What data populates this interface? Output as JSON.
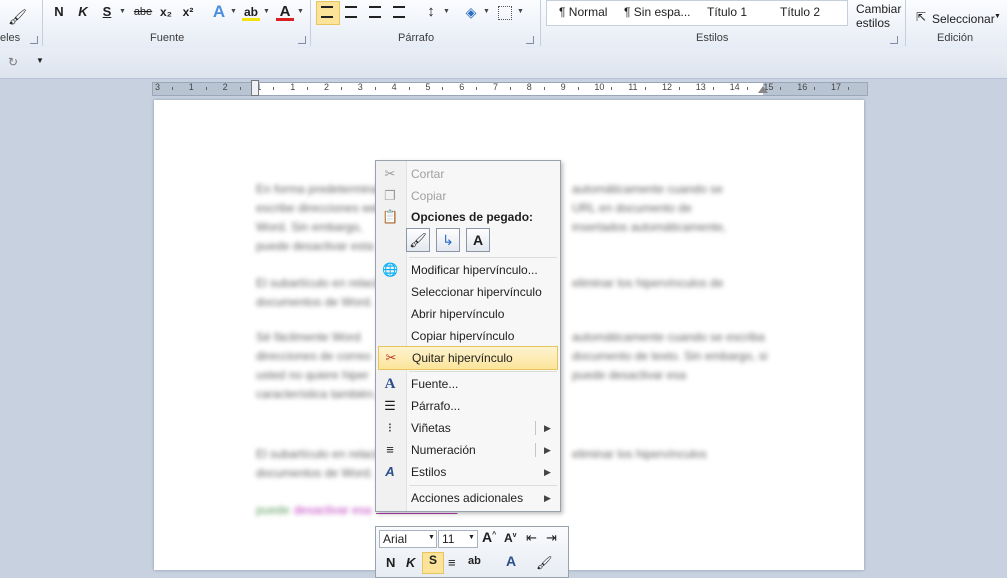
{
  "ribbon": {
    "clipboard_label": "eles",
    "font_group_label": "Fuente",
    "paragraph_group_label": "Párrafo",
    "styles_group_label": "Estilos",
    "edit_group_label": "Edición",
    "bold": "N",
    "italic": "K",
    "underline": "S",
    "strike": "abe",
    "subscript": "x₂",
    "superscript": "x²",
    "styles": [
      "¶ Normal",
      "¶ Sin espa...",
      "Título 1",
      "Título 2"
    ],
    "change_styles": "Cambiar\nestilos",
    "change_styles_l1": "Cambiar",
    "change_styles_l2": "estilos",
    "select": "Seleccionar",
    "accent_color": "#f6d56c"
  },
  "ruler": {
    "numbers": [
      "3",
      "1",
      "2",
      "1",
      "1",
      "2",
      "3",
      "4",
      "5",
      "6",
      "7",
      "8",
      "9",
      "10",
      "11",
      "12",
      "13",
      "14",
      "15",
      "16",
      "17"
    ]
  },
  "context_menu": {
    "cut": "Cortar",
    "copy": "Copiar",
    "paste_options": "Opciones de pegado:",
    "modify_link": "Modificar hipervínculo...",
    "select_link": "Seleccionar hipervínculo",
    "open_link": "Abrir hipervínculo",
    "copy_link": "Copiar hipervínculo",
    "remove_link": "Quitar hipervínculo",
    "font": "Fuente...",
    "paragraph": "Párrafo...",
    "bullets": "Viñetas",
    "numbering": "Numeración",
    "styles": "Estilos",
    "more_actions": "Acciones adicionales"
  },
  "mini_toolbar": {
    "font_name": "Arial",
    "font_size": "11"
  },
  "document": {
    "visible_text": "también."
  },
  "colors": {
    "highlight_item": "#fbe49a",
    "page": "#ffffff",
    "workspace": "#c7d1df"
  }
}
